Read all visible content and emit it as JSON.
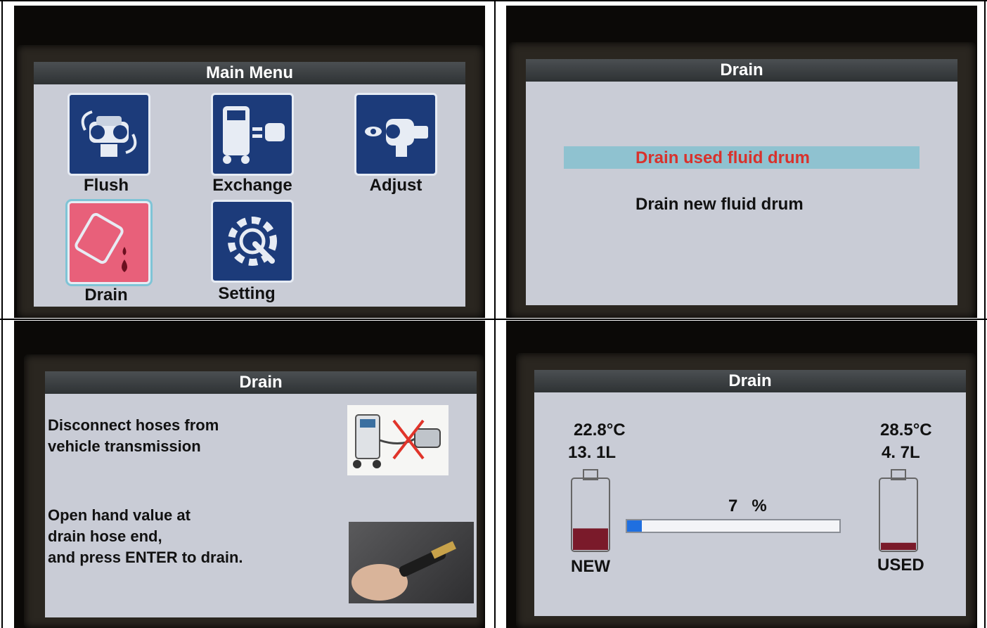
{
  "panel1": {
    "title": "Main Menu",
    "items": [
      {
        "label": "Flush",
        "icon": "flush-icon"
      },
      {
        "label": "Exchange",
        "icon": "exchange-machine-icon"
      },
      {
        "label": "Adjust",
        "icon": "adjust-icon"
      },
      {
        "label": "Drain",
        "icon": "drain-drum-icon",
        "selected": true
      },
      {
        "label": "Setting",
        "icon": "gear-wrench-icon"
      }
    ]
  },
  "panel2": {
    "title": "Drain",
    "options": [
      {
        "label": "Drain used fluid drum",
        "selected": true
      },
      {
        "label": "Drain new fluid drum",
        "selected": false
      }
    ]
  },
  "panel3": {
    "title": "Drain",
    "instruction1": "Disconnect hoses from\nvehicle transmission",
    "instruction2": "Open hand value at\ndrain hose end,\nand press ENTER to drain."
  },
  "panel4": {
    "title": "Drain",
    "new": {
      "temp": "22.8°C",
      "volume": "13. 1L",
      "label": "NEW",
      "fill": 0.3
    },
    "used": {
      "temp": "28.5°C",
      "volume": "4. 7L",
      "label": "USED",
      "fill": 0.1
    },
    "progress_text": "7   %",
    "progress": 0.07
  },
  "colors": {
    "tile_blue": "#1c3b7a",
    "tile_pink": "#e8607a",
    "selected_text": "#d8322c",
    "fluid": "#7a1a2a",
    "progress_blue": "#1f6fe0"
  }
}
